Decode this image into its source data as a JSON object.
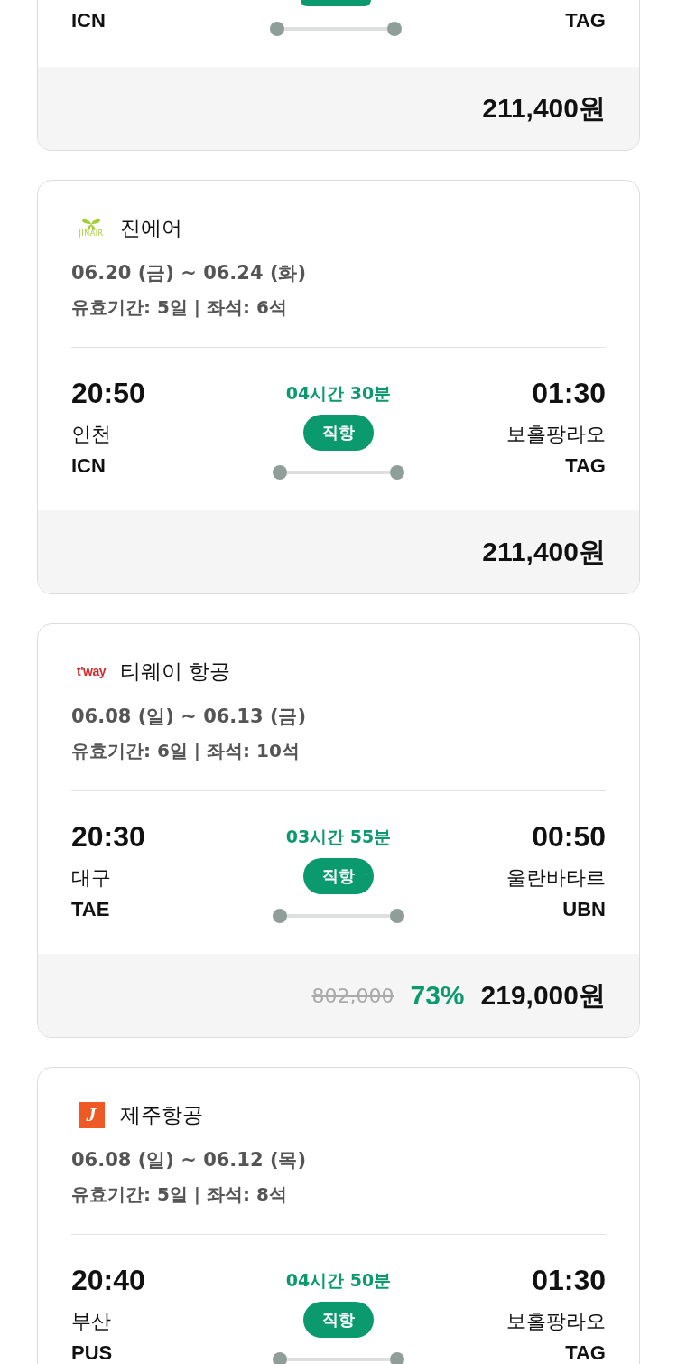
{
  "cards": [
    {
      "kind": "partial",
      "from_code": "ICN",
      "to_code": "TAG",
      "price": "211,400원"
    },
    {
      "kind": "full",
      "airline": {
        "kind": "jinair",
        "logo_text": "JINAIR",
        "name": "진에어"
      },
      "dates": "06.20 (금) ~ 06.24 (화)",
      "validity": "유효기간: 5일 | 좌석: 6석",
      "depart_time": "20:50",
      "depart_city": "인천",
      "depart_code": "ICN",
      "duration": "04시간 30분",
      "route_type": "직항",
      "arrive_time": "01:30",
      "arrive_city": "보홀팡라오",
      "arrive_code": "TAG",
      "price": "211,400원"
    },
    {
      "kind": "full",
      "airline": {
        "kind": "tway",
        "logo_text": "t'way",
        "name": "티웨이 항공"
      },
      "dates": "06.08 (일) ~ 06.13 (금)",
      "validity": "유효기간: 6일 | 좌석: 10석",
      "depart_time": "20:30",
      "depart_city": "대구",
      "depart_code": "TAE",
      "duration": "03시간 55분",
      "route_type": "직항",
      "arrive_time": "00:50",
      "arrive_city": "울란바타르",
      "arrive_code": "UBN",
      "original_price": "802,000",
      "discount": "73%",
      "price": "219,000원"
    },
    {
      "kind": "full",
      "airline": {
        "kind": "jeju",
        "logo_text": "J",
        "name": "제주항공"
      },
      "dates": "06.08 (일) ~ 06.12 (목)",
      "validity": "유효기간: 5일 | 좌석: 8석",
      "depart_time": "20:40",
      "depart_city": "부산",
      "depart_code": "PUS",
      "duration": "04시간 50분",
      "route_type": "직항",
      "arrive_time": "01:30",
      "arrive_city": "보홀팡라오",
      "arrive_code": "TAG"
    }
  ]
}
